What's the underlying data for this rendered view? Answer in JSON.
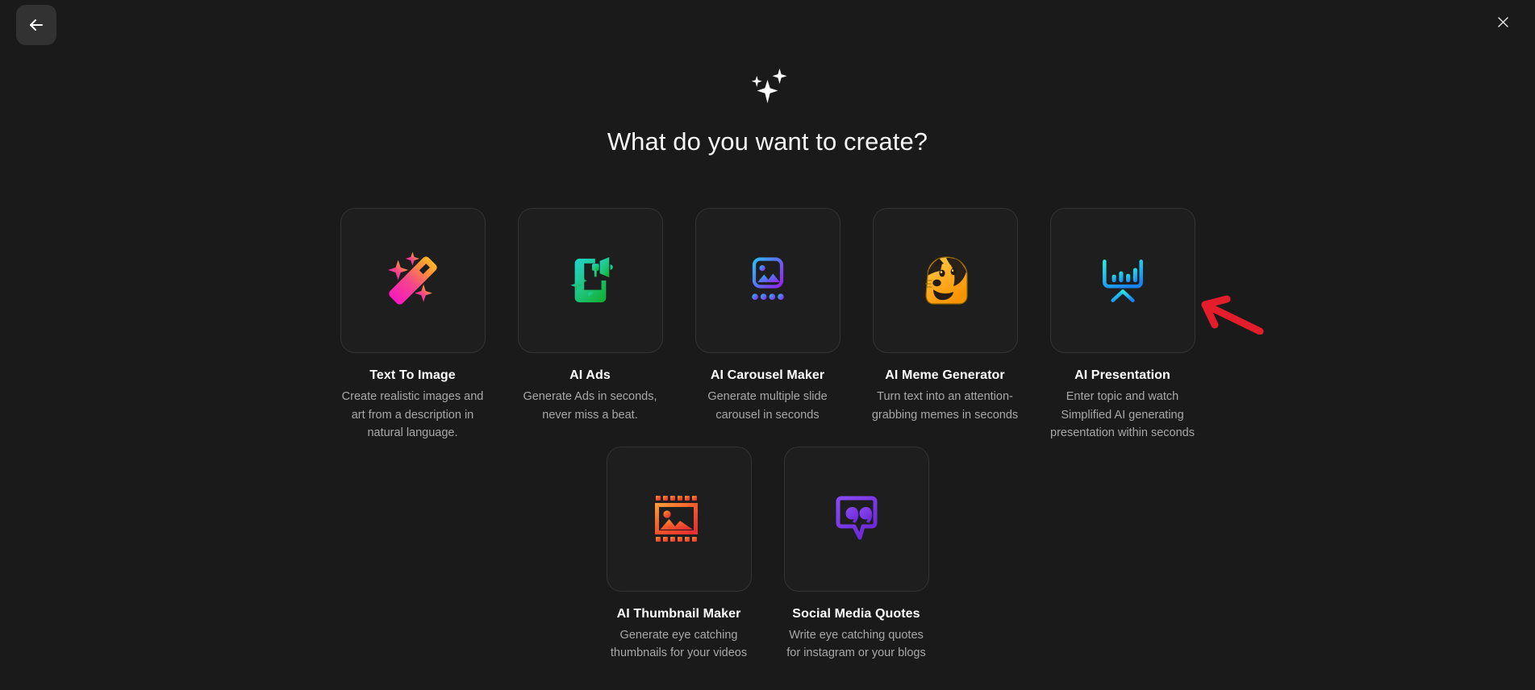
{
  "window": {
    "background_color": "#1a1a1a",
    "back_button": {
      "name": "back-button",
      "icon": "arrow-left-icon",
      "label": ""
    },
    "close_button": {
      "name": "close-button",
      "icon": "close-icon",
      "label": ""
    }
  },
  "header": {
    "icon": "sparkles-icon",
    "title": "What do you want to create?"
  },
  "annotation": {
    "type": "arrow",
    "color": "#e31e2a",
    "points_to": "AI Presentation"
  },
  "colors": {
    "card_background": "#1e1e1e",
    "card_border": "#333333",
    "title_text": "#ffffff",
    "description_text": "#a8a8a8",
    "accent_text_to_image": "#f5365c",
    "accent_ai_ads": "#22c55e",
    "accent_carousel": "#3b82f6",
    "accent_meme": "#f9a825",
    "accent_presentation": "#1d8ef0",
    "accent_thumbnail": "#f2541b",
    "accent_quotes": "#7c3aed"
  },
  "rows": [
    {
      "cards": [
        {
          "id": "text-to-image",
          "icon": "magic-wand-icon",
          "title": "Text To Image",
          "description": "Create realistic images and art from a description in natural language."
        },
        {
          "id": "ai-ads",
          "icon": "phone-megaphone-icon",
          "title": "AI Ads",
          "description": "Generate Ads in seconds, never miss a beat."
        },
        {
          "id": "ai-carousel-maker",
          "icon": "carousel-image-icon",
          "title": "AI Carousel Maker",
          "description": "Generate multiple slide carousel in seconds"
        },
        {
          "id": "ai-meme-generator",
          "icon": "doge-face-icon",
          "title": "AI Meme Generator",
          "description": "Turn text into an attention-grabbing memes in seconds"
        },
        {
          "id": "ai-presentation",
          "icon": "presentation-chart-icon",
          "title": "AI Presentation",
          "description": "Enter topic and watch Simplified AI generating presentation within seconds"
        }
      ]
    },
    {
      "cards": [
        {
          "id": "ai-thumbnail-maker",
          "icon": "film-strip-image-icon",
          "title": "AI Thumbnail Maker",
          "description": "Generate eye catching thumbnails for your videos"
        },
        {
          "id": "social-media-quotes",
          "icon": "quote-bubble-icon",
          "title": "Social Media Quotes",
          "description": "Write eye catching quotes for instagram or your blogs"
        }
      ]
    }
  ]
}
